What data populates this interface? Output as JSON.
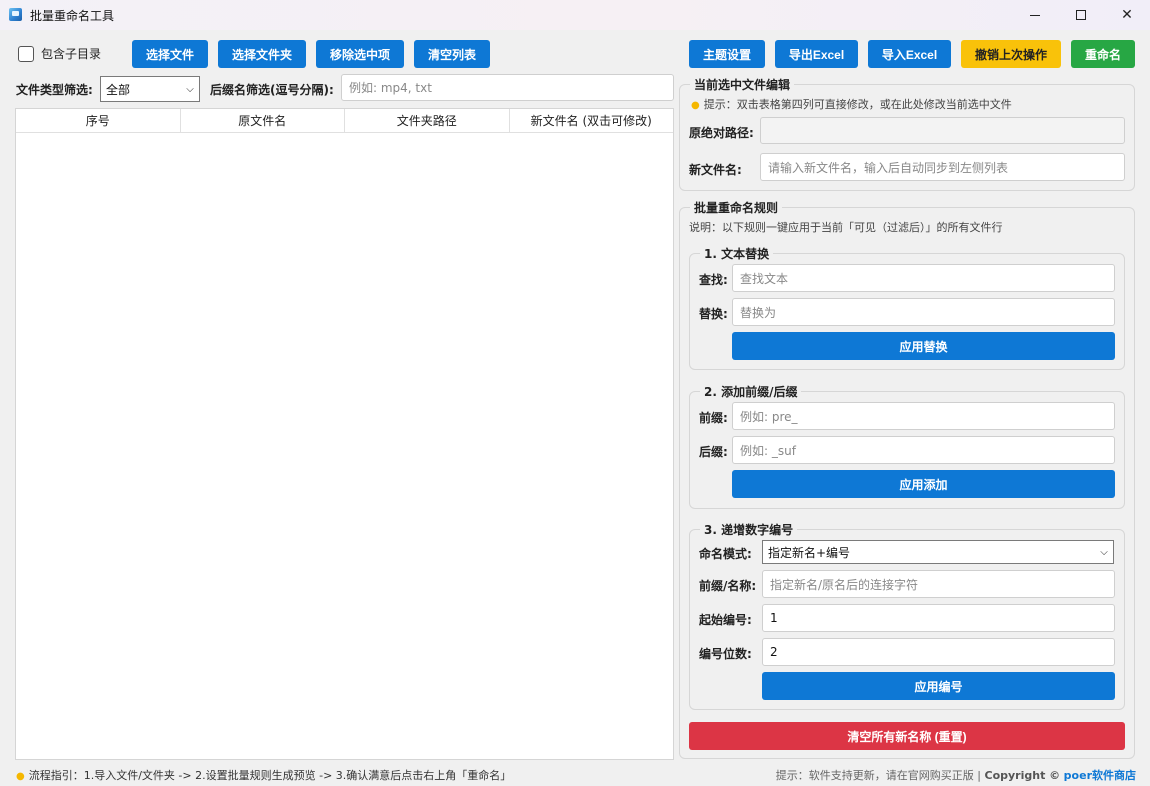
{
  "window": {
    "title": "批量重命名工具"
  },
  "toolbar": {
    "include_subdirs_label": "包含子目录",
    "select_files": "选择文件",
    "select_folder": "选择文件夹",
    "remove_selected": "移除选中项",
    "clear_list": "清空列表",
    "theme_settings": "主题设置",
    "export_excel": "导出Excel",
    "import_excel": "导入Excel",
    "undo_last": "撤销上次操作",
    "rename": "重命名"
  },
  "filter": {
    "type_label": "文件类型筛选:",
    "type_value": "全部",
    "ext_label": "后缀名筛选(逗号分隔):",
    "ext_placeholder": "例如: mp4, txt"
  },
  "table": {
    "columns": [
      "序号",
      "原文件名",
      "文件夹路径",
      "新文件名 (双击可修改)"
    ],
    "rows": []
  },
  "edit_panel": {
    "title": "当前选中文件编辑",
    "hint": "提示：双击表格第四列可直接修改，或在此处修改当前选中文件",
    "path_label": "原绝对路径:",
    "path_value": "",
    "newname_label": "新文件名:",
    "newname_placeholder": "请输入新文件名，输入后自动同步到左侧列表"
  },
  "rules_panel": {
    "title": "批量重命名规则",
    "note": "说明：以下规则一键应用于当前「可见（过滤后）」的所有文件行",
    "replace": {
      "title": "1. 文本替换",
      "find_label": "查找:",
      "find_placeholder": "查找文本",
      "replace_label": "替换:",
      "replace_placeholder": "替换为",
      "apply": "应用替换"
    },
    "affix": {
      "title": "2. 添加前缀/后缀",
      "prefix_label": "前缀:",
      "prefix_placeholder": "例如: pre_",
      "suffix_label": "后缀:",
      "suffix_placeholder": "例如: _suf",
      "apply": "应用添加"
    },
    "numbering": {
      "title": "3. 递增数字编号",
      "mode_label": "命名模式:",
      "mode_value": "指定新名+编号",
      "name_label": "前缀/名称:",
      "name_placeholder": "指定新名/原名后的连接字符",
      "start_label": "起始编号:",
      "start_value": "1",
      "digits_label": "编号位数:",
      "digits_value": "2",
      "apply": "应用编号"
    },
    "reset": "清空所有新名称 (重置)"
  },
  "footer": {
    "guide": "流程指引：1.导入文件/文件夹 -> 2.设置批量规则生成预览 -> 3.确认满意后点击右上角「重命名」",
    "update_hint": "提示：软件支持更新，请在官网购买正版 |",
    "copyright": "Copyright ©",
    "brand": "poer软件商店"
  },
  "colors": {
    "primary": "#0e78d5",
    "warning": "#f9c20a",
    "success": "#27a744",
    "danger": "#dc3545"
  }
}
